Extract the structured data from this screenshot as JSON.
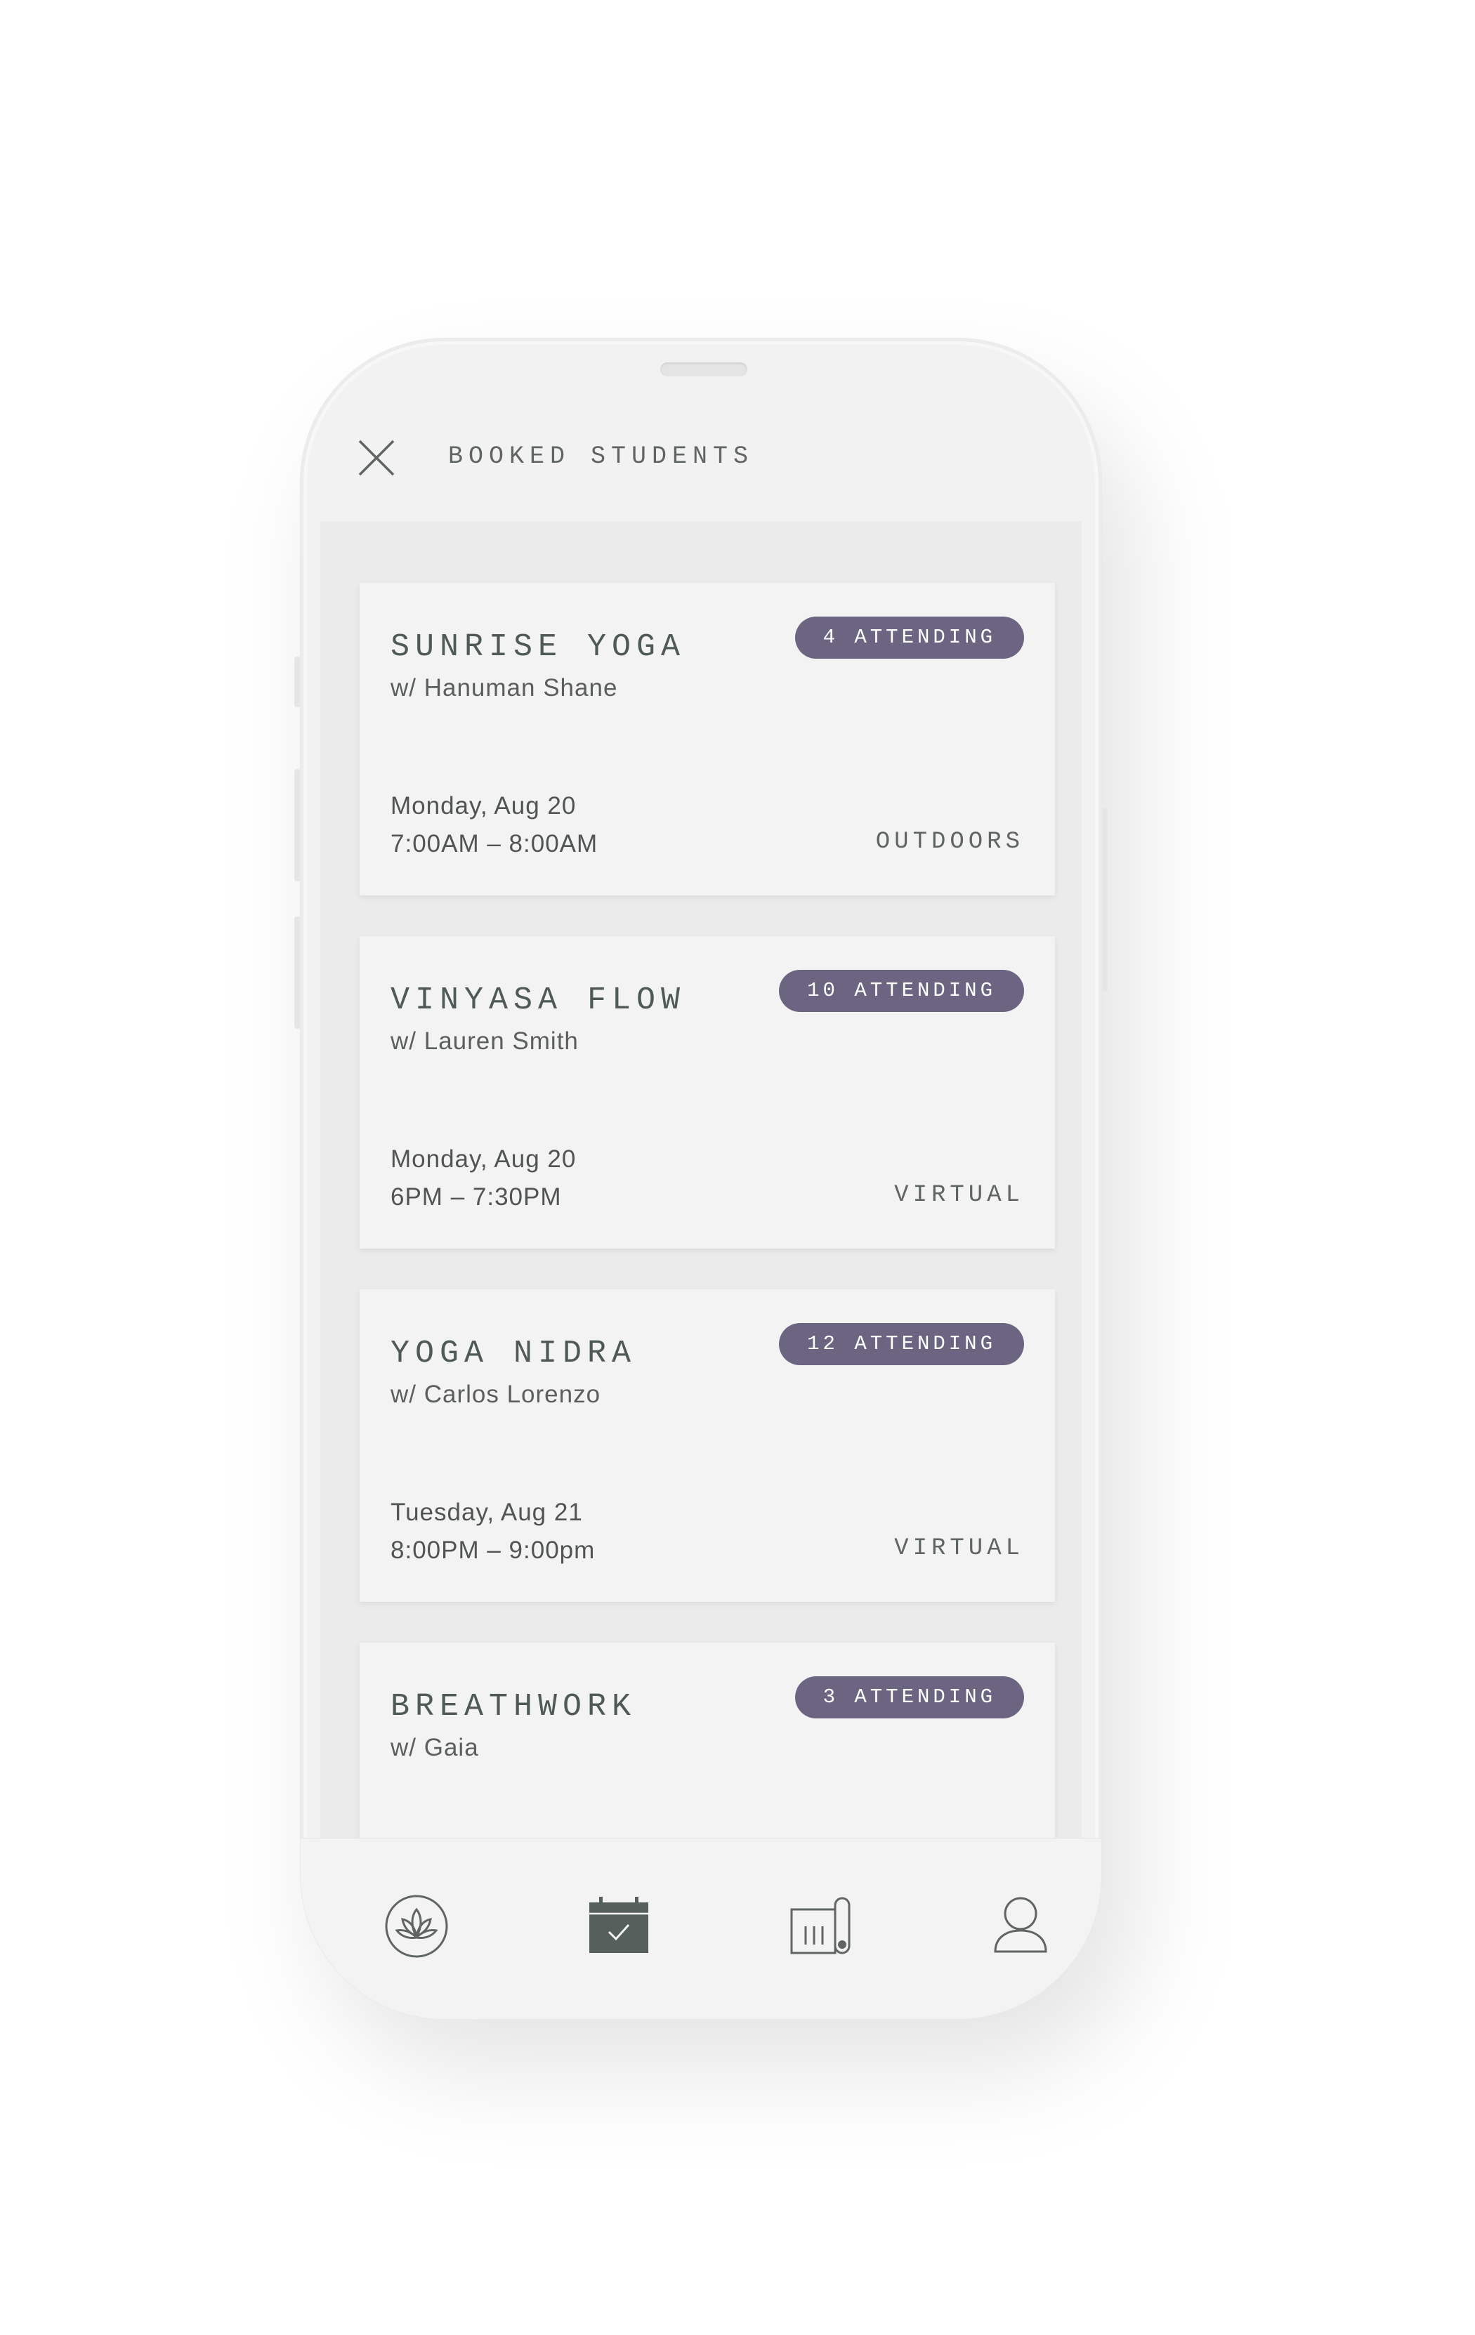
{
  "header": {
    "title": "BOOKED STUDENTS",
    "close_icon": "close-icon"
  },
  "classes": [
    {
      "name": "SUNRISE YOGA",
      "instructor": "w/ Hanuman Shane",
      "attending": "4 ATTENDING",
      "date": "Monday, Aug 20",
      "time": "7:00AM – 8:00AM",
      "location": "OUTDOORS"
    },
    {
      "name": "VINYASA FLOW",
      "instructor": "w/ Lauren Smith",
      "attending": "10 ATTENDING",
      "date": "Monday, Aug 20",
      "time": "6PM – 7:30PM",
      "location": "VIRTUAL"
    },
    {
      "name": "YOGA NIDRA",
      "instructor": "w/ Carlos Lorenzo",
      "attending": "12 ATTENDING",
      "date": "Tuesday, Aug 21",
      "time": "8:00PM – 9:00pm",
      "location": "VIRTUAL"
    },
    {
      "name": "BREATHWORK",
      "instructor": "w/ Gaia",
      "attending": "3 ATTENDING",
      "date": "",
      "time": "",
      "location": ""
    }
  ],
  "tabbar": {
    "tabs": [
      {
        "icon": "lotus-icon",
        "active": false
      },
      {
        "icon": "calendar-check-icon",
        "active": true
      },
      {
        "icon": "yoga-mat-icon",
        "active": false
      },
      {
        "icon": "profile-icon",
        "active": false
      }
    ]
  },
  "colors": {
    "badge": "#6b6582",
    "active_icon": "#55605c",
    "text": "#4f5a56"
  }
}
